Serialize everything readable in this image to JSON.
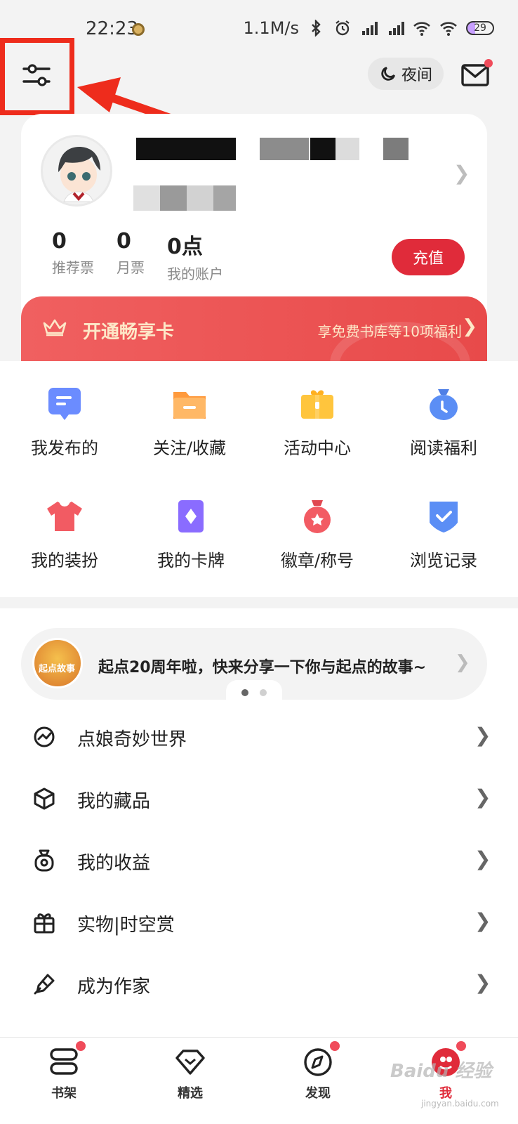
{
  "status_bar": {
    "time": "22:23",
    "speed": "1.1M/s",
    "battery": "29",
    "icons": [
      "bluetooth-icon",
      "alarm-icon",
      "hd-signal-icon",
      "hd-signal-icon",
      "wifi-plus-icon",
      "wifi-icon",
      "battery-icon"
    ]
  },
  "top_bar": {
    "night_label": "夜间",
    "icons": [
      "filter-icon",
      "moon-icon",
      "mail-icon"
    ]
  },
  "profile": {
    "stats": [
      {
        "value": "0",
        "label": "推荐票"
      },
      {
        "value": "0",
        "label": "月票"
      },
      {
        "value": "0点",
        "label": "我的账户"
      }
    ],
    "recharge_label": "充值"
  },
  "vip": {
    "title": "开通畅享卡",
    "subtitle": "享免费书库等10项福利",
    "chevron": "❯"
  },
  "grid": [
    {
      "label": "我发布的",
      "icon": "chat-icon",
      "color": "#6b8cff"
    },
    {
      "label": "关注/收藏",
      "icon": "folder-icon",
      "color": "#ff9a3d"
    },
    {
      "label": "活动中心",
      "icon": "gift-icon",
      "color": "#ffc53d"
    },
    {
      "label": "阅读福利",
      "icon": "money-bag-icon",
      "color": "#5b8ef5"
    },
    {
      "label": "我的装扮",
      "icon": "shirt-icon",
      "color": "#f25b63"
    },
    {
      "label": "我的卡牌",
      "icon": "card-icon",
      "color": "#8a6cff"
    },
    {
      "label": "徽章/称号",
      "icon": "medal-icon",
      "color": "#f25b63"
    },
    {
      "label": "浏览记录",
      "icon": "shield-check-icon",
      "color": "#5b8ef5"
    }
  ],
  "promo": {
    "text": "起点20周年啦，快来分享一下你与起点的故事~",
    "image_caption": "起点故事",
    "chevron": "❯",
    "dot_colors": [
      "#666666",
      "#d0d0d0"
    ]
  },
  "menu": [
    {
      "label": "点娘奇妙世界",
      "icon": "world-icon"
    },
    {
      "label": "我的藏品",
      "icon": "cube-icon"
    },
    {
      "label": "我的收益",
      "icon": "earnings-icon"
    },
    {
      "label": "实物|时空赏",
      "icon": "gift-box-icon"
    },
    {
      "label": "成为作家",
      "icon": "pen-icon"
    }
  ],
  "menu_chevron": "❯",
  "profile_chevron": "❯",
  "bottom_nav": [
    {
      "label": "书架",
      "icon": "bookshelf-icon"
    },
    {
      "label": "精选",
      "icon": "diamond-icon"
    },
    {
      "label": "发现",
      "icon": "compass-icon"
    },
    {
      "label": "我",
      "icon": "me-avatar-icon"
    }
  ],
  "watermark": {
    "text": "Baidu 经验",
    "sub": "jingyan.baidu.com"
  },
  "colors": {
    "accent": "#e02b3a",
    "annotation": "#ee2c1c",
    "badge": "#f04b5a"
  }
}
